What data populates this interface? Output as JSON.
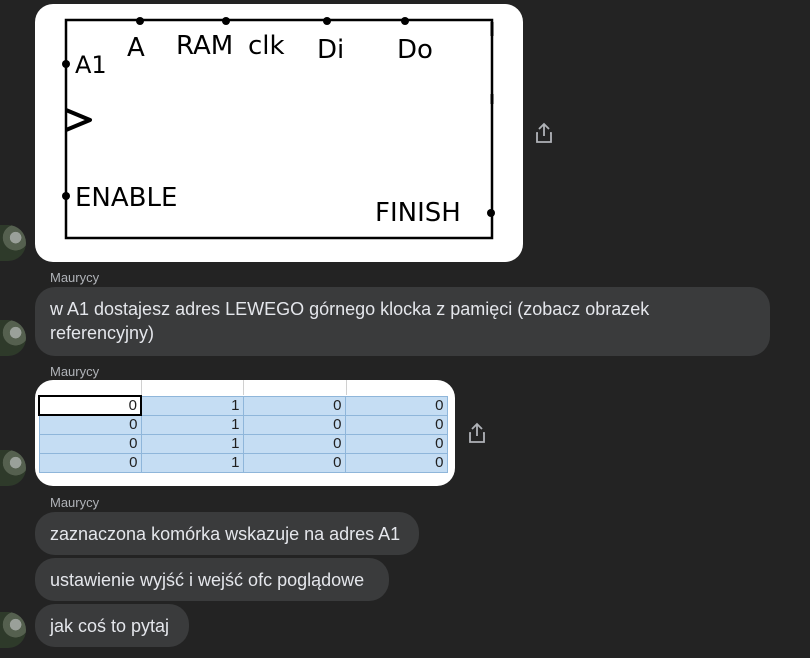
{
  "messages": [
    {
      "type": "image",
      "alt": "diagram"
    },
    {
      "sender": "Maurycy",
      "text_line1": "w A1 dostajesz adres LEWEGO górnego klocka z pamięci (zobacz obrazek",
      "text_line2": "referencyjny)"
    },
    {
      "sender": "Maurycy",
      "type": "spreadsheet"
    },
    {
      "sender": "Maurycy",
      "text": "zaznaczona komórka wskazuje na adres A1"
    },
    {
      "text": "ustawienie wyjść i wejść ofc poglądowe"
    },
    {
      "text": "jak coś to pytaj"
    }
  ],
  "diagram": {
    "labels_top": [
      "A",
      "RAM",
      "clk",
      "Di",
      "Do"
    ],
    "label_a1": "A1",
    "label_enable": "ENABLE",
    "label_finish": "FINISH"
  },
  "spreadsheet": {
    "rows": [
      [
        "0",
        "1",
        "0",
        "0"
      ],
      [
        "0",
        "1",
        "0",
        "0"
      ],
      [
        "0",
        "1",
        "0",
        "0"
      ],
      [
        "0",
        "1",
        "0",
        "0"
      ]
    ],
    "active_cell": "A1"
  },
  "icons": {
    "share": "share-icon",
    "avatar": "avatar"
  }
}
